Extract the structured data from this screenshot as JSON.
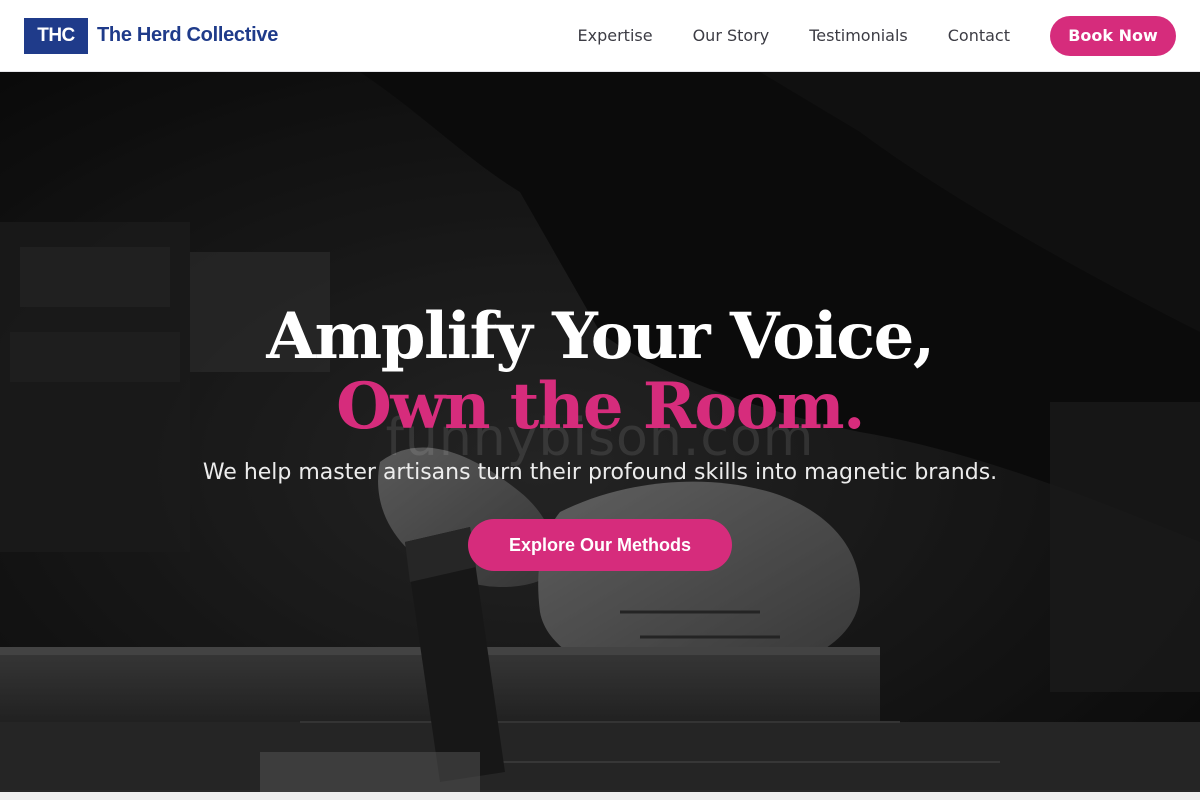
{
  "header": {
    "logo_text": "THC",
    "brand_name": "The Herd Collective",
    "nav": [
      {
        "label": "Expertise"
      },
      {
        "label": "Our Story"
      },
      {
        "label": "Testimonials"
      },
      {
        "label": "Contact"
      }
    ],
    "cta_label": "Book Now"
  },
  "hero": {
    "title_line1": "Amplify Your Voice,",
    "title_line2": "Own the Room.",
    "subtitle": "We help master artisans turn their profound skills into magnetic brands.",
    "cta_label": "Explore Our Methods",
    "watermark": "funnybison.com",
    "image": "black-and-white photo of artisan hands sawing wood"
  },
  "colors": {
    "brand_blue": "#1f3b8a",
    "accent_pink": "#d62c7c",
    "nav_text": "#3c3c44"
  }
}
